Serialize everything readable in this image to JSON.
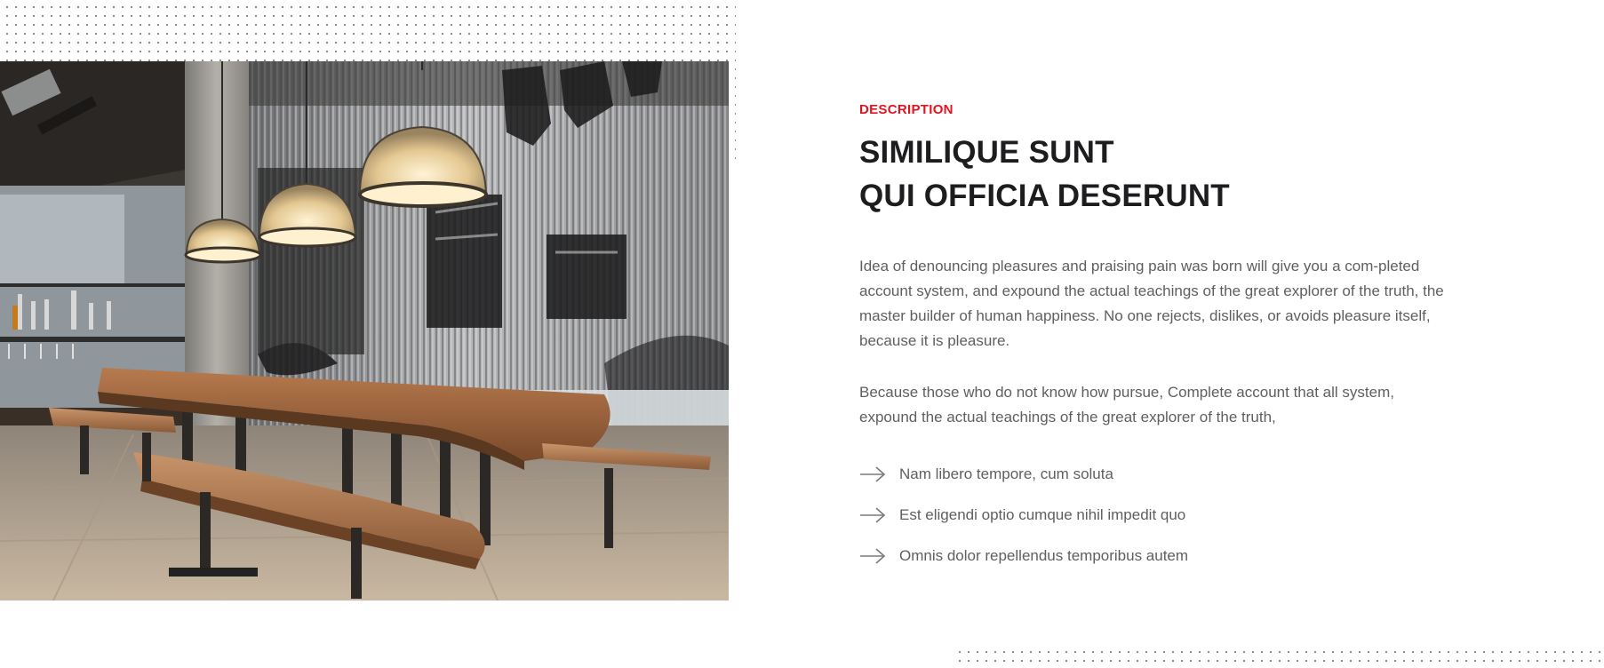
{
  "section": {
    "eyebrow": "DESCRIPTION",
    "title_line_1": "SIMILIQUE SUNT",
    "title_line_2": "QUI OFFICIA DESERUNT",
    "paragraph_1": "Idea of denouncing pleasures and praising pain was born will give you a com-pleted account system, and expound the actual teachings of the great explorer of the truth, the master builder of human happiness. No one rejects, dislikes, or avoids pleasure itself, because it is pleasure.",
    "paragraph_2": "Because those who do not know how pursue, Complete account that all system, expound the actual teachings of the great explorer of the truth,",
    "features": [
      {
        "label": "Nam libero tempore, cum soluta",
        "icon": "arrow-right-icon"
      },
      {
        "label": "Est eligendi optio cumque nihil impedit quo",
        "icon": "arrow-right-icon"
      },
      {
        "label": "Omnis dolor repellendus temporibus autem",
        "icon": "arrow-right-icon"
      }
    ]
  },
  "image": {
    "subject": "restaurant-interior-photo"
  },
  "colors": {
    "accent": "#e0141e",
    "heading": "#1d1d1f",
    "body_text": "#5f5f5f",
    "dots": "#6b6b6b"
  }
}
